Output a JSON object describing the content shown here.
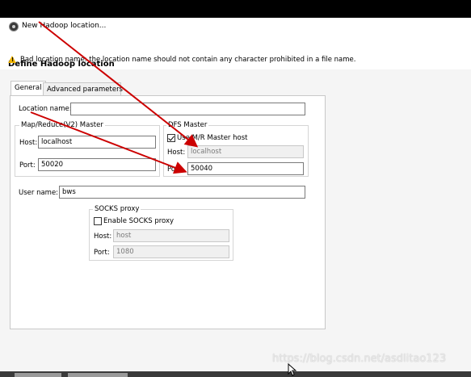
{
  "window": {
    "title": "New Hadoop location..."
  },
  "header": {
    "page_title": "Define Hadoop location",
    "warning": "Bad location name: the location name should not contain any character prohibited in a file name."
  },
  "tabs": [
    {
      "label": "General"
    },
    {
      "label": "Advanced parameters"
    }
  ],
  "general": {
    "location_name_label": "Location name:",
    "location_name_value": "",
    "mapreduce": {
      "title": "Map/Reduce(V2) Master",
      "host_label": "Host:",
      "host_value": "localhost",
      "port_label": "Port:",
      "port_value": "50020"
    },
    "dfs": {
      "title": "DFS Master",
      "use_mr_label": "Use M/R Master host",
      "use_mr_checked": true,
      "host_label": "Host:",
      "host_value": "localhost",
      "port_label": "Port:",
      "port_value": "50040"
    },
    "user_name_label": "User name:",
    "user_name_value": "bws",
    "socks": {
      "title": "SOCKS proxy",
      "enable_label": "Enable SOCKS proxy",
      "enable_checked": false,
      "host_label": "Host:",
      "host_value": "host",
      "port_label": "Port:",
      "port_value": "1080"
    }
  },
  "watermark": "https://blog.csdn.net/asdlitao123",
  "colors": {
    "annotation_arrow": "#cc0000",
    "warning": "#f0b400"
  },
  "icons": {
    "app": "hadoop-elephant-icon",
    "warning": "warning-icon"
  }
}
